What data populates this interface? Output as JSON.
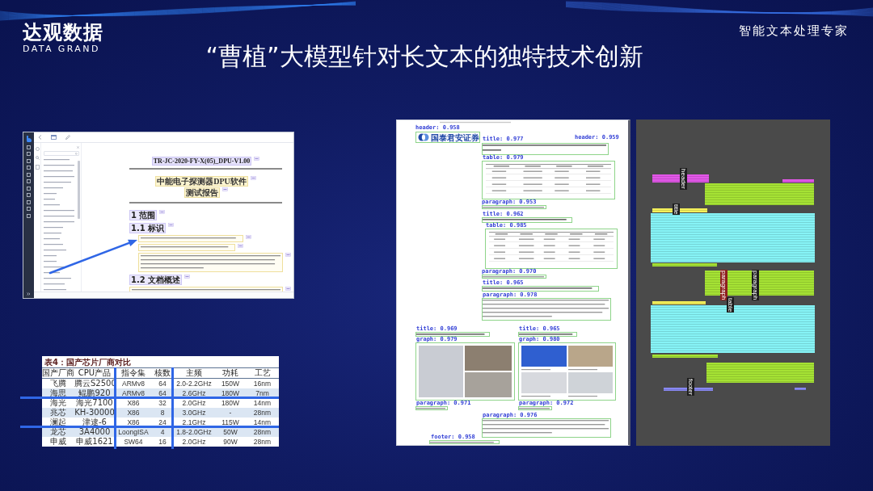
{
  "brand": {
    "name": "达观数据",
    "subtitle": "DATA GRAND"
  },
  "tagline": "智能文本处理专家",
  "title": "“曹植”大模型针对长文本的独特技术创新",
  "editor_screenshot": {
    "doc_id": "TR-JC-2020-FY-X(05)_DPU-V1.00",
    "doc_title": [
      "中能电子探测器DPU软件",
      "测试报告"
    ],
    "headings": [
      "1 范围",
      "1.1 标识",
      "1.2 文档概述"
    ]
  },
  "chip_table": {
    "caption": "表4：国产芯片厂商对比",
    "columns": [
      "国产厂商",
      "CPU产品",
      "指令集",
      "核数",
      "主频",
      "功耗",
      "工艺"
    ],
    "rows": [
      [
        "飞腾",
        "腾云S2500",
        "ARMv8",
        "64",
        "2.0-2.2GHz",
        "150W",
        "16nm"
      ],
      [
        "海思",
        "鲲鹏920",
        "ARMv8",
        "64",
        "2.6GHz",
        "180W",
        "7nm"
      ],
      [
        "海光",
        "海光7100",
        "X86",
        "32",
        "2.0GHz",
        "180W",
        "14nm"
      ],
      [
        "兆芯",
        "KH-30000",
        "X86",
        "8",
        "3.0GHz",
        "-",
        "28nm"
      ],
      [
        "澜起",
        "津逮-6",
        "X86",
        "24",
        "2.1GHz",
        "115W",
        "14nm"
      ],
      [
        "龙芯",
        "3A4000",
        "LoongISA",
        "4",
        "1.8-2.0GHz",
        "50W",
        "28nm"
      ],
      [
        "申威",
        "申威1621",
        "SW64",
        "16",
        "2.0GHz",
        "90W",
        "28nm"
      ]
    ]
  },
  "detection_page": {
    "logo_text": "国泰君安证券",
    "detections": [
      {
        "kind": "header",
        "label": "header: 0.958"
      },
      {
        "kind": "title",
        "label": "title: 0.977"
      },
      {
        "kind": "header",
        "label": "header: 0.959"
      },
      {
        "kind": "table",
        "label": "table: 0.979"
      },
      {
        "kind": "paragraph",
        "label": "paragraph: 0.953"
      },
      {
        "kind": "title",
        "label": "title: 0.962"
      },
      {
        "kind": "table",
        "label": "table: 0.985"
      },
      {
        "kind": "paragraph",
        "label": "paragraph: 0.970"
      },
      {
        "kind": "title",
        "label": "title: 0.965"
      },
      {
        "kind": "paragraph",
        "label": "paragraph: 0.978"
      },
      {
        "kind": "title",
        "label": "title: 0.969"
      },
      {
        "kind": "graph",
        "label": "graph: 0.979"
      },
      {
        "kind": "title",
        "label": "title: 0.965"
      },
      {
        "kind": "graph",
        "label": "graph: 0.980"
      },
      {
        "kind": "paragraph",
        "label": "paragraph: 0.971"
      },
      {
        "kind": "paragraph",
        "label": "paragraph: 0.972"
      },
      {
        "kind": "paragraph",
        "label": "paragraph: 0.976"
      },
      {
        "kind": "footer",
        "label": "footer: 0.958"
      }
    ]
  },
  "layout_page": {
    "regions": [
      {
        "kind": "header"
      },
      {
        "kind": "header"
      },
      {
        "kind": "paragraph"
      },
      {
        "kind": "title"
      },
      {
        "kind": "table"
      },
      {
        "kind": "paragraph"
      },
      {
        "kind": "paragraph"
      },
      {
        "kind": "title"
      },
      {
        "kind": "table"
      },
      {
        "kind": "paragraph"
      },
      {
        "kind": "paragraph"
      },
      {
        "kind": "footer"
      },
      {
        "kind": "footer"
      }
    ],
    "tags": [
      {
        "kind": "plain",
        "text": "header"
      },
      {
        "kind": "plain",
        "text": "title"
      },
      {
        "kind": "alert",
        "text": "paragraph"
      },
      {
        "kind": "plain",
        "text": "paragraph"
      },
      {
        "kind": "plain",
        "text": "table"
      },
      {
        "kind": "plain",
        "text": "footer"
      }
    ]
  }
}
